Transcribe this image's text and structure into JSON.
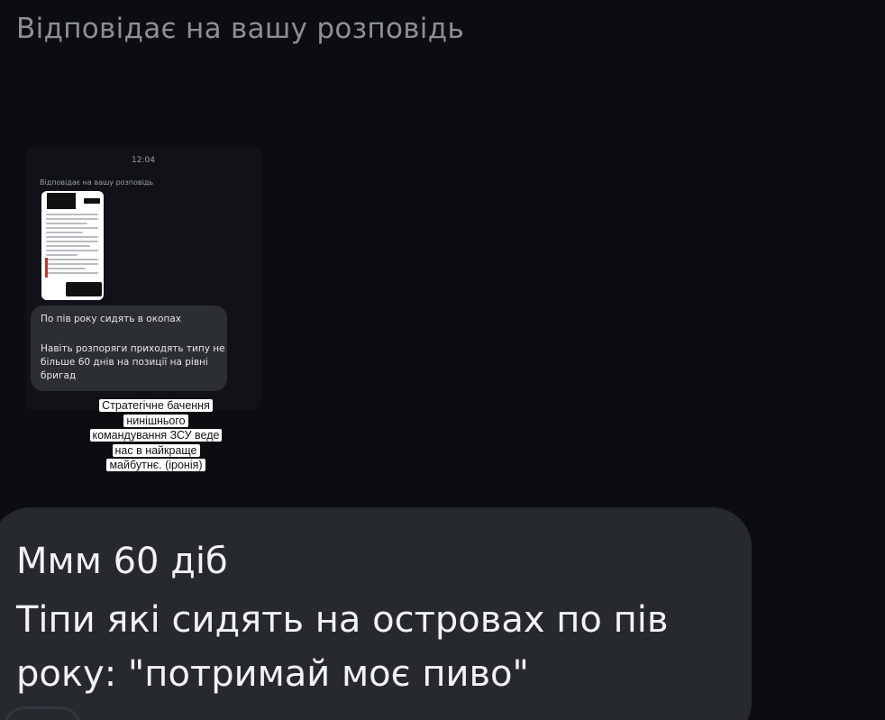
{
  "header": {
    "reply_label": "Відповідає на вашу розповідь"
  },
  "story": {
    "time": "12:04",
    "reply_label": "Відповідає на вашу розповідь",
    "bubble_line1": "По пів року сидять в окопах",
    "bubble_line2": "Навіть розпоряги приходять типу не більше 60 днів на позиції на рівні бригад",
    "caption_sticker": "Стратегічне бачення нинішнього командування ЗСУ веде нас в найкраще майбутнє. (іронія)"
  },
  "message": {
    "line1": "Ммм 60 діб",
    "line2": "Тіпи які сидять на островах по пів",
    "line3": "року: \"потримай моє пиво\""
  },
  "colors": {
    "background": "#0c0d10",
    "bubble": "#262a2f",
    "header_text": "#8b8f96",
    "message_text": "#f2f2f4"
  }
}
